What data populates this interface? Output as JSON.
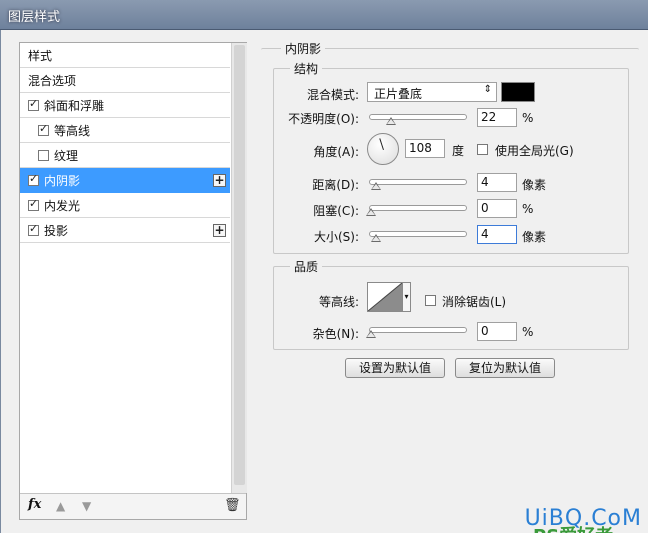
{
  "window": {
    "title": "图层样式"
  },
  "left_list": {
    "items": [
      {
        "label": "样式",
        "checkbox": false,
        "checked": false,
        "selected": false,
        "add": false
      },
      {
        "label": "混合选项",
        "checkbox": false,
        "checked": false,
        "selected": false,
        "add": false
      },
      {
        "label": "斜面和浮雕",
        "checkbox": true,
        "checked": true,
        "selected": false,
        "add": false
      },
      {
        "label": "等高线",
        "checkbox": true,
        "checked": true,
        "selected": false,
        "add": false,
        "indent": true
      },
      {
        "label": "纹理",
        "checkbox": true,
        "checked": false,
        "selected": false,
        "add": false,
        "indent": true
      },
      {
        "label": "内阴影",
        "checkbox": true,
        "checked": true,
        "selected": true,
        "add": true
      },
      {
        "label": "内发光",
        "checkbox": true,
        "checked": true,
        "selected": false,
        "add": false
      },
      {
        "label": "投影",
        "checkbox": true,
        "checked": true,
        "selected": false,
        "add": true
      }
    ],
    "footer_fx": "fx"
  },
  "inner_shadow": {
    "section_title": "内阴影",
    "structure": {
      "group_title": "结构",
      "blend_mode_label": "混合模式:",
      "blend_mode_value": "正片叠底",
      "shadow_color": "#000000",
      "opacity_label": "不透明度(O):",
      "opacity_value": "22",
      "opacity_unit": "%",
      "angle_label": "角度(A):",
      "angle_value": "108",
      "angle_unit": "度",
      "global_light_label": "使用全局光(G)",
      "global_light_checked": false,
      "distance_label": "距离(D):",
      "distance_value": "4",
      "distance_unit": "像素",
      "choke_label": "阻塞(C):",
      "choke_value": "0",
      "choke_unit": "%",
      "size_label": "大小(S):",
      "size_value": "4",
      "size_unit": "像素"
    },
    "quality": {
      "group_title": "品质",
      "contour_label": "等高线:",
      "anti_alias_label": "消除锯齿(L)",
      "anti_alias_checked": false,
      "noise_label": "杂色(N):",
      "noise_value": "0",
      "noise_unit": "%"
    },
    "buttons": {
      "make_default": "设置为默认值",
      "reset_default": "复位为默认值"
    }
  },
  "watermark": {
    "text": "UiBQ.CoM",
    "text2": "PS爱好者"
  }
}
